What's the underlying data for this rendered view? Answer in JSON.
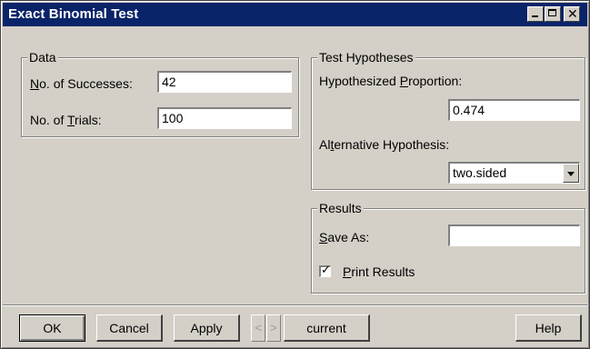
{
  "window": {
    "title": "Exact Binomial Test",
    "controls": [
      "minimize-icon",
      "maximize-icon",
      "close-icon"
    ]
  },
  "data_group": {
    "title": "Data",
    "successes_label_prefix": "N",
    "successes_label_rest": "o. of Successes:",
    "successes_value": "42",
    "trials_label_prefix": "No. of ",
    "trials_label_underlined": "T",
    "trials_label_rest": "rials:",
    "trials_value": "100"
  },
  "hypotheses_group": {
    "title": "Test Hypotheses",
    "proportion_label_prefix": "Hypothesized ",
    "proportion_label_underlined": "P",
    "proportion_label_rest": "roportion:",
    "proportion_value": "0.474",
    "alternative_label_prefix": "Al",
    "alternative_label_underlined": "t",
    "alternative_label_rest": "ernative Hypothesis:",
    "alternative_value": "two.sided"
  },
  "results_group": {
    "title": "Results",
    "save_as_label_underlined": "S",
    "save_as_label_rest": "ave As:",
    "save_as_value": "",
    "print_results_label_underlined": "P",
    "print_results_label_rest": "rint Results",
    "print_results_checked": true
  },
  "buttons": {
    "ok": "OK",
    "cancel": "Cancel",
    "apply": "Apply",
    "prev": "<",
    "next": ">",
    "current": "current",
    "help": "Help"
  }
}
